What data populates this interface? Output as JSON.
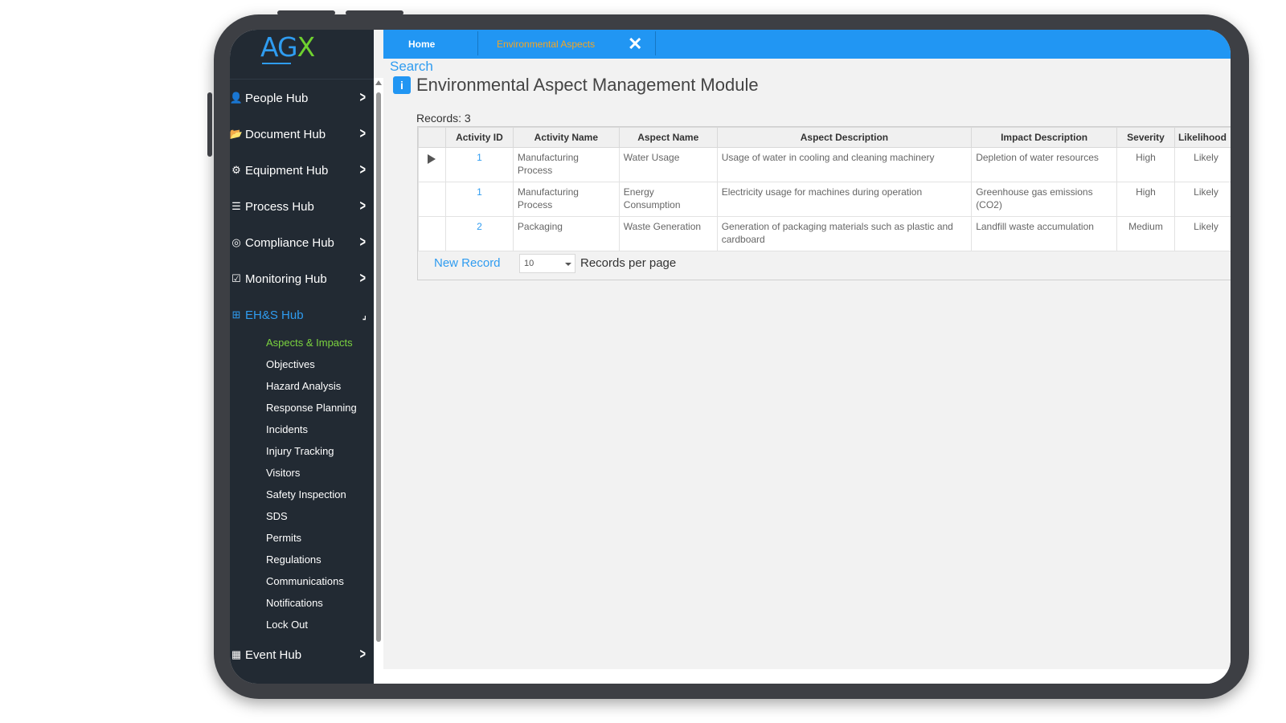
{
  "logo": {
    "a_part": "AG",
    "x_part": "X"
  },
  "tabs": {
    "home": "Home",
    "env": "Environmental Aspects",
    "close": "✕"
  },
  "sidebar": {
    "hubs": [
      {
        "label": "People Hub",
        "icon": "user-icon",
        "glyph": "👤"
      },
      {
        "label": "Document Hub",
        "icon": "folder-icon",
        "glyph": "📂"
      },
      {
        "label": "Equipment Hub",
        "icon": "gears-icon",
        "glyph": "⚙"
      },
      {
        "label": "Process Hub",
        "icon": "list-icon",
        "glyph": "☰"
      },
      {
        "label": "Compliance Hub",
        "icon": "target-icon",
        "glyph": "◎"
      },
      {
        "label": "Monitoring Hub",
        "icon": "checkbox-icon",
        "glyph": "☑"
      },
      {
        "label": "EH&S Hub",
        "icon": "plus-square-icon",
        "glyph": "⊞"
      },
      {
        "label": "Event Hub",
        "icon": "calendar-icon",
        "glyph": "▦"
      }
    ],
    "subitems": [
      "Aspects & Impacts",
      "Objectives",
      "Hazard Analysis",
      "Response Planning",
      "Incidents",
      "Injury Tracking",
      "Visitors",
      "Safety Inspection",
      "SDS",
      "Permits",
      "Regulations",
      "Communications",
      "Notifications",
      "Lock Out"
    ]
  },
  "main": {
    "search": "Search",
    "title": "Environmental Aspect Management Module",
    "records": "Records:  3",
    "columns": [
      "Activity ID",
      "Activity Name",
      "Aspect Name",
      "Aspect Description",
      "Impact Description",
      "Severity",
      "Likelihood"
    ],
    "rows": [
      [
        "1",
        "Manufacturing Process",
        "Water Usage",
        "Usage of water in cooling and cleaning machinery",
        "Depletion of water resources",
        "High",
        "Likely"
      ],
      [
        "1",
        "Manufacturing Process",
        "Energy Consumption",
        "Electricity usage for machines during operation",
        "Greenhouse gas emissions (CO2)",
        "High",
        "Likely"
      ],
      [
        "2",
        "Packaging",
        "Waste Generation",
        "Generation of packaging materials such as plastic and cardboard",
        "Landfill waste accumulation",
        "Medium",
        "Likely"
      ]
    ],
    "new_record": "New Record",
    "per_page_value": "10",
    "per_page_label": "Records per page"
  },
  "colors": {
    "accent": "#2196f3",
    "active_sub": "#7bd33f",
    "tab_active": "#f5a623",
    "sidebar_bg": "#222a33"
  }
}
